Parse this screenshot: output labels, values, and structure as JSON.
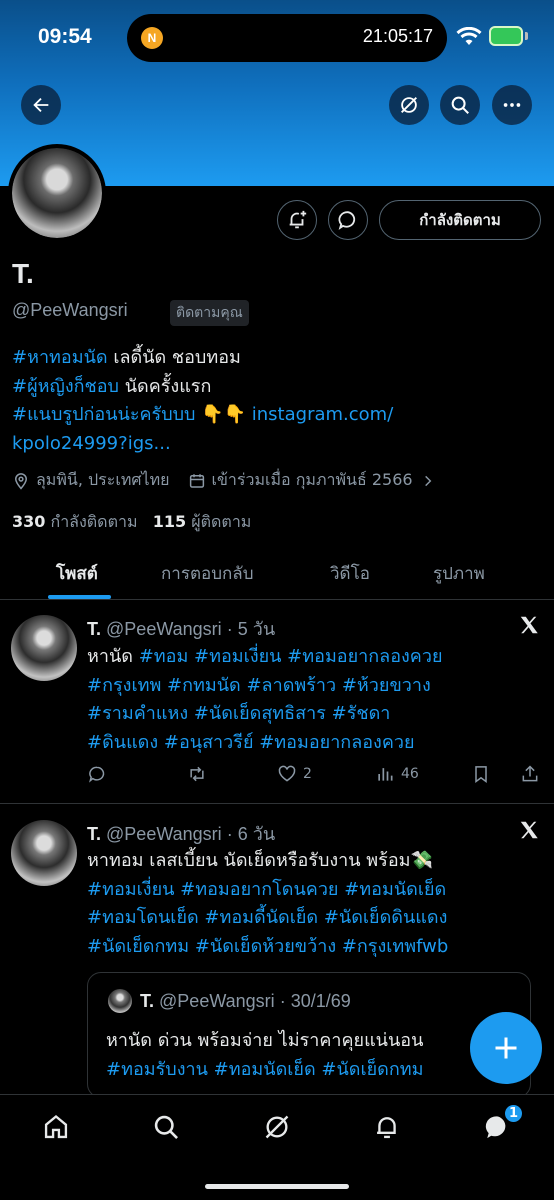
{
  "status_bar": {
    "time": "09:54",
    "island_app_letter": "N",
    "island_clock": "21:05:17"
  },
  "profile": {
    "name": "T.",
    "handle": "@PeeWangsri",
    "follows_you": "ติดตามคุณ",
    "following_button": "กำลังติดตาม",
    "bio": {
      "line1_tag": "#หาทอมนัด",
      "line1_text": " เลดี้นัด ชอบทอม",
      "line2_tag": "#ผู้หญิงก็ชอบ",
      "line2_text": " นัดครั้งแรก",
      "line3_tag": "#แนบรูปก่อนน่ะครับบบ",
      "line3_emoji": " 👇👇 ",
      "line3_link": "instagram.com/",
      "line4_link": "kpolo24999?igs..."
    },
    "location": "ลุมพินี, ประเทศไทย",
    "joined": "เข้าร่วมเมื่อ กุมภาพันธ์ 2566",
    "following_count": "330",
    "following_label": "กำลังติดตาม",
    "followers_count": "115",
    "followers_label": "ผู้ติดตาม"
  },
  "tabs": [
    "โพสต์",
    "การตอบกลับ",
    "วิดีโอ",
    "รูปภาพ"
  ],
  "posts": [
    {
      "name": "T.",
      "handle": "@PeeWangsri",
      "time": "· 5 วัน",
      "line1_text": "หานัด ",
      "line1_tags": "#ทอม #ทอมเงี่ยน #ทอมอยากลองควย",
      "line2": "#กรุงเทพ #กทมนัด  #ลาดพร้าว #ห้วยขวาง",
      "line3": "#รามคำแหง  #นัดเย็ดสุทธิสาร #รัชดา",
      "line4": "#ดินแดง #อนุสาวรีย์ #ทอมอยากลองควย",
      "likes": "2",
      "views": "46"
    },
    {
      "name": "T.",
      "handle": "@PeeWangsri",
      "time": "· 6 วัน",
      "line1_text": "หาทอม เลสเบี้ยน นัดเย็ดหรือรับงาน พร้อม💸",
      "line2": "#ทอมเงี่ยน  #ทอมอยากโดนควย #ทอมนัดเย็ด",
      "line3": "#ทอมโดนเย็ด #ทอมดี้นัดเย็ด  #นัดเย็ดดินแดง",
      "line4": "#นัดเย็ดกทม #นัดเย็ดห้วยขว้าง #กรุงเทพfwb"
    }
  ],
  "quote": {
    "name": "T.",
    "handle": "@PeeWangsri",
    "time": "· 30/1/69",
    "line1": "หานัด ด่วน พร้อมจ่าย ไม่ราคาคุยแน่นอน",
    "line2": "#ทอมรับงาน  #ทอมนัดเย็ด  #นัดเย็ดกทม"
  },
  "nav": {
    "messages_badge": "1"
  },
  "colors": {
    "accent": "#1d9bf0",
    "background": "#000000",
    "secondary_text": "#8b98a5"
  }
}
